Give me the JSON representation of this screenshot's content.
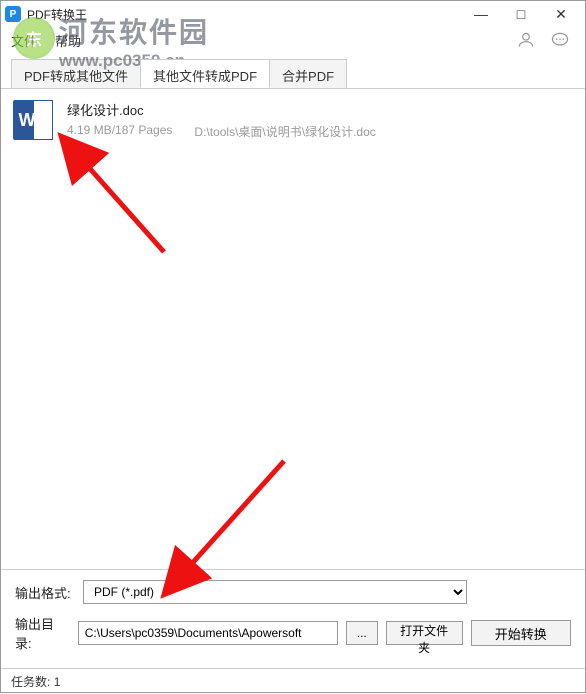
{
  "window": {
    "title": "PDF转换王"
  },
  "menu": {
    "file": "文件",
    "help": "帮助"
  },
  "watermark": {
    "text": "河东软件园",
    "url": "www.pc0359.cn"
  },
  "tabs": [
    {
      "label": "PDF转成其他文件"
    },
    {
      "label": "其他文件转成PDF"
    },
    {
      "label": "合并PDF"
    }
  ],
  "active_tab": 1,
  "file": {
    "name": "绿化设计.doc",
    "size_pages": "4.19 MB/187 Pages",
    "path": "D:\\tools\\桌面\\说明书\\绿化设计.doc",
    "icon_letter": "W"
  },
  "output": {
    "format_label": "输出格式:",
    "format_value": "PDF (*.pdf)",
    "dir_label": "输出目录:",
    "dir_value": "C:\\Users\\pc0359\\Documents\\Apowersoft",
    "browse": "...",
    "open_folder": "打开文件夹",
    "start": "开始转换"
  },
  "status": {
    "tasks_label": "任务数:",
    "tasks_count": "1"
  }
}
